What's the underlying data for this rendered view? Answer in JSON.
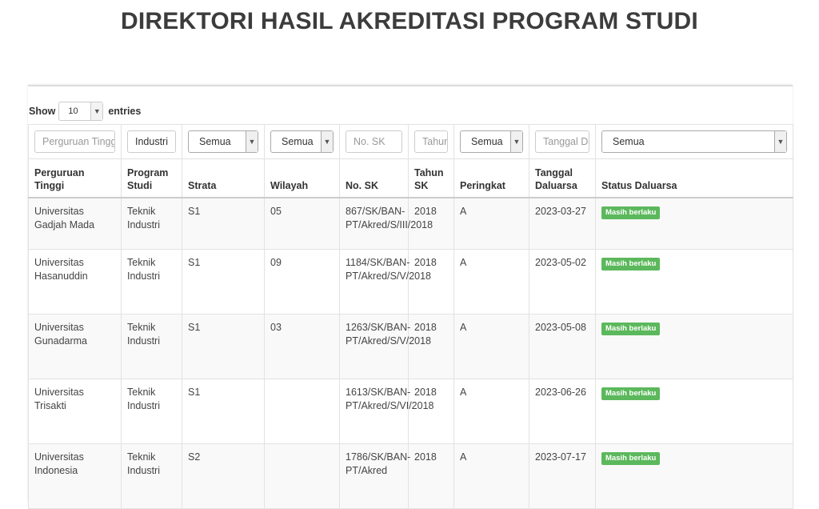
{
  "page": {
    "title": "DIREKTORI HASIL AKREDITASI PROGRAM STUDI"
  },
  "length_menu": {
    "show_label": "Show",
    "value": "10",
    "entries_label": "entries"
  },
  "filters": {
    "perguruan_tinggi": {
      "placeholder": "Perguruan Tinggi",
      "value": ""
    },
    "program_studi": {
      "value": "Industri"
    },
    "strata": {
      "selected": "Semua"
    },
    "wilayah": {
      "selected": "Semua"
    },
    "no_sk": {
      "placeholder": "No. SK",
      "value": ""
    },
    "tahun": {
      "placeholder": "Tahun",
      "value": ""
    },
    "peringkat": {
      "selected": "Semua"
    },
    "tanggal": {
      "placeholder": "Tanggal Daluarsa",
      "value": ""
    },
    "status": {
      "selected": "Semua"
    }
  },
  "columns": [
    "Perguruan Tinggi",
    "Program Studi",
    "Strata",
    "Wilayah",
    "No. SK",
    "Tahun SK",
    "Peringkat",
    "Tanggal Daluarsa",
    "Status Daluarsa"
  ],
  "rows": [
    {
      "pt": "Universitas Gadjah Mada",
      "prodi": "Teknik Industri",
      "strata": "S1",
      "wilayah": "05",
      "sk": "867/SK/BAN-PT/Akred/S/III/2018",
      "tahun": "2018",
      "peringkat": "A",
      "tanggal": "2023-03-27",
      "status": "Masih berlaku"
    },
    {
      "pt": "Universitas Hasanuddin",
      "prodi": "Teknik Industri",
      "strata": "S1",
      "wilayah": "09",
      "sk": "1184/SK/BAN-PT/Akred/S/V/2018",
      "tahun": "2018",
      "peringkat": "A",
      "tanggal": "2023-05-02",
      "status": "Masih berlaku"
    },
    {
      "pt": "Universitas Gunadarma",
      "prodi": "Teknik Industri",
      "strata": "S1",
      "wilayah": "03",
      "sk": "1263/SK/BAN-PT/Akred/S/V/2018",
      "tahun": "2018",
      "peringkat": "A",
      "tanggal": "2023-05-08",
      "status": "Masih berlaku"
    },
    {
      "pt": "Universitas Trisakti",
      "prodi": "Teknik Industri",
      "strata": "S1",
      "wilayah": "",
      "sk": "1613/SK/BAN-PT/Akred/S/VI/2018",
      "tahun": "2018",
      "peringkat": "A",
      "tanggal": "2023-06-26",
      "status": "Masih berlaku"
    },
    {
      "pt": "Universitas Indonesia",
      "prodi": "Teknik Industri",
      "strata": "S2",
      "wilayah": "",
      "sk": "1786/SK/BAN-PT/Akred",
      "tahun": "2018",
      "peringkat": "A",
      "tanggal": "2023-07-17",
      "status": "Masih berlaku"
    }
  ],
  "colors": {
    "badge_success": "#5cb85c"
  }
}
